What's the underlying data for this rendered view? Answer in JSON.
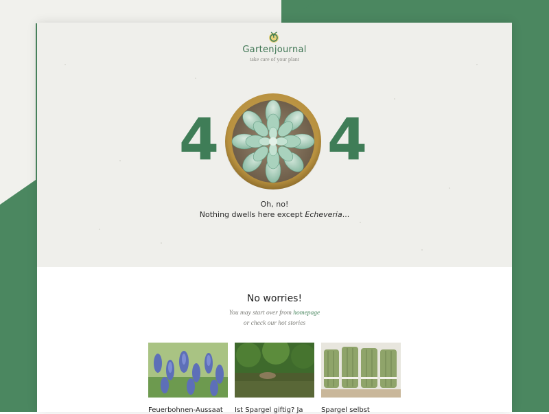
{
  "brand": {
    "name": "Gartenjournal",
    "tagline": "take care of your plant",
    "accent": "#4b8760"
  },
  "error": {
    "digit_left": "4",
    "digit_right": "4",
    "line1": "Oh, no!",
    "line2_prefix": "Nothing dwells here except ",
    "line2_plant": "Echeveria",
    "line2_suffix": "..."
  },
  "recovery": {
    "heading": "No worries!",
    "start_prefix": "You may start over from ",
    "homepage_link": "homepage",
    "hot_stories": "or check our hot stories"
  },
  "stories": [
    {
      "title": "Feuerbohnen-Aussaat",
      "image": "grape-hyacinth-photo"
    },
    {
      "title": "Ist Spargel giftig? Ja",
      "image": "river-forest-photo"
    },
    {
      "title": "Spargel selbst",
      "image": "asparagus-bundles-photo"
    }
  ]
}
